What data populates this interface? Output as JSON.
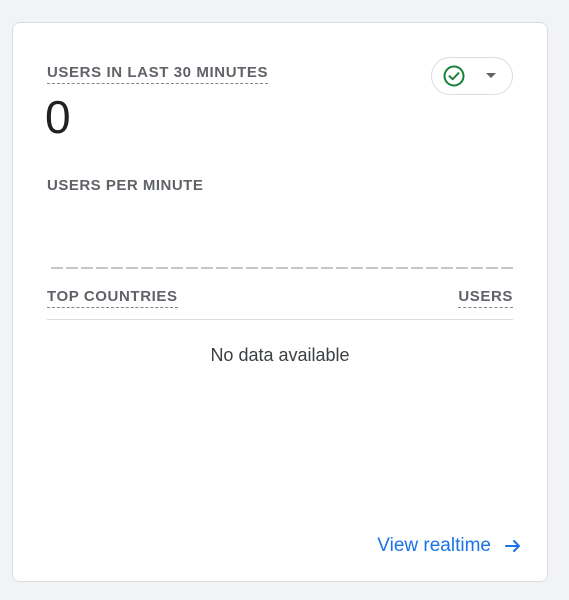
{
  "card": {
    "users_label": "USERS IN LAST 30 MINUTES",
    "users_value": "0",
    "per_minute_label": "USERS PER MINUTE",
    "table": {
      "col_country": "TOP COUNTRIES",
      "col_users": "USERS",
      "empty_text": "No data available"
    },
    "link_label": "View realtime",
    "icons": {
      "status": "check-circle-icon",
      "dropdown": "caret-down-icon",
      "link": "arrow-right-icon"
    },
    "colors": {
      "status_green": "#188038",
      "link_blue": "#1a73e8"
    }
  }
}
